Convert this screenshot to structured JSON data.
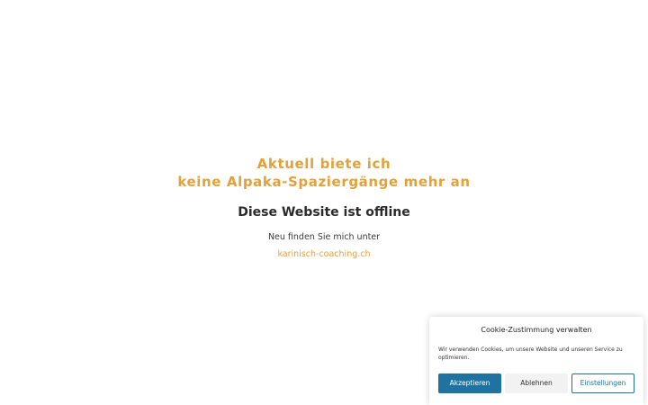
{
  "main": {
    "headline_line1": "Aktuell biete ich",
    "headline_line2": "keine Alpaka-Spaziergänge mehr an",
    "subtitle": "Diese Website ist offline",
    "info_text": "Neu finden Sie mich unter",
    "link_text": "karinisch-coaching.ch"
  },
  "cookie": {
    "title": "Cookie-Zustimmung verwalten",
    "text": "Wir verwenden Cookies, um unsere Website und unseren Service zu optimieren.",
    "accept_label": "Akzeptieren",
    "decline_label": "Ablehnen",
    "settings_label": "Einstellungen"
  },
  "colors": {
    "accent": "#e3a13a",
    "button_primary": "#1e73a0"
  }
}
